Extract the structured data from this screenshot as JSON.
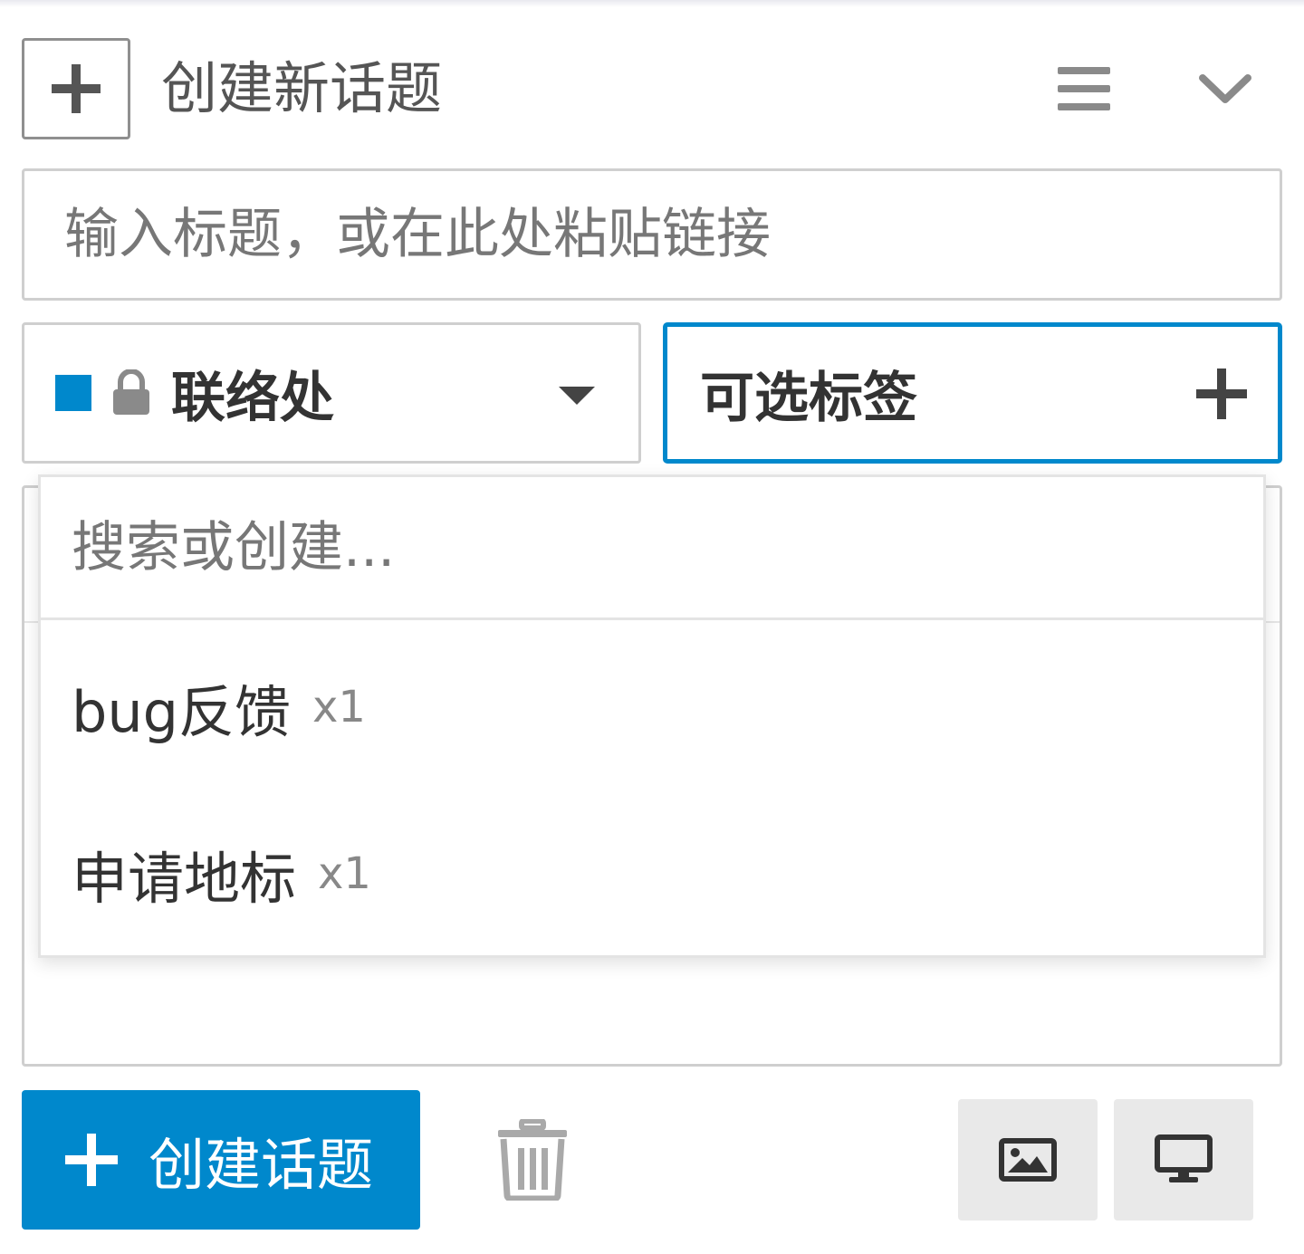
{
  "header": {
    "title": "创建新话题",
    "icons": [
      "plus-icon",
      "hamburger-menu-icon",
      "chevron-down-icon"
    ]
  },
  "title_input": {
    "value": "",
    "placeholder": "输入标题，或在此处粘贴链接"
  },
  "category": {
    "label": "联络处",
    "color": "#0088cc",
    "icons": [
      "lock-icon",
      "caret-down-icon"
    ]
  },
  "tags": {
    "label": "可选标签",
    "icon": "plus-icon",
    "focus_color": "#0088cc"
  },
  "tag_dropdown": {
    "search_placeholder": "搜索或创建...",
    "items": [
      {
        "name": "bug反馈",
        "count": "x1"
      },
      {
        "name": "申请地标",
        "count": "x1"
      }
    ]
  },
  "footer": {
    "create_label": "创建话题",
    "create_color": "#0088cc",
    "icons": [
      "plus-icon",
      "trash-icon",
      "image-icon",
      "desktop-icon"
    ]
  }
}
